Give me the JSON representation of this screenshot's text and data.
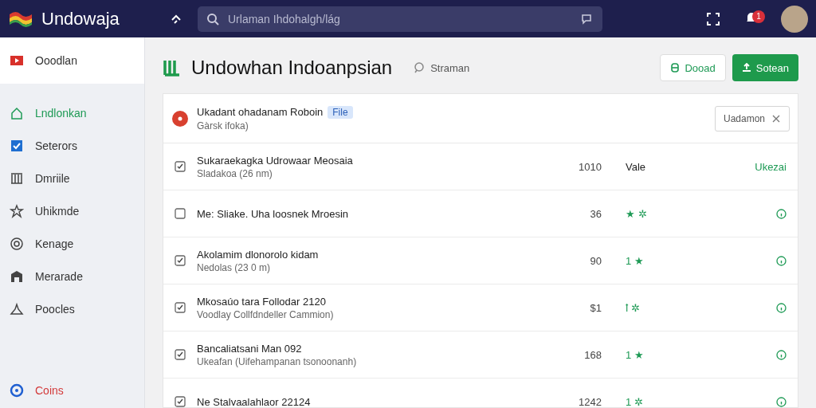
{
  "topbar": {
    "app_name": "Undowaja",
    "search": {
      "placeholder": "Urlaman Ihdohalgh/lág"
    },
    "notification_badge": "1"
  },
  "sidebar": {
    "top_item": {
      "label": "Ooodlan"
    },
    "items": [
      {
        "label": "Lndlonkan",
        "selected": true
      },
      {
        "label": "Seterors",
        "selected": false
      },
      {
        "label": "Dmriile",
        "selected": false
      },
      {
        "label": "Uhikmde",
        "selected": false
      },
      {
        "label": "Kenage",
        "selected": false
      },
      {
        "label": "Merarade",
        "selected": false
      },
      {
        "label": "Poocles",
        "selected": false
      }
    ],
    "bottom_item": {
      "label": "Coins"
    }
  },
  "header": {
    "title": "Undowhan Indoanpsian",
    "subtitle": "Straman",
    "buttons": [
      {
        "label": "Dooad",
        "kind": "outline"
      },
      {
        "label": "Sotean",
        "kind": "primary"
      }
    ]
  },
  "card": {
    "title": "Ukadant ohadanam Roboin",
    "tag": "File",
    "subtitle": "Gàrsk ifoka)",
    "filter_chip": "Uadamon",
    "rows": [
      {
        "title": "Sukaraekagka Udrowaar Meosaia",
        "subtitle": "Sladakoa (26 nm)",
        "checked": true,
        "number": "1010",
        "rating": "Vale",
        "end": {
          "kind": "label",
          "text": "Ukezai"
        }
      },
      {
        "title": "Me: Sliake. Uha loosnek Mroesin",
        "checked": false,
        "number": "36",
        "rating": "★ ✲",
        "end": {
          "kind": "info"
        }
      },
      {
        "title": "Akolamim dlonorolo kidam",
        "subtitle": "Nedolas (23 0 m)",
        "checked": true,
        "number": "90",
        "rating": "1 ★",
        "end": {
          "kind": "info"
        }
      },
      {
        "title": "Mkosaúo tara Follodar 2120",
        "subtitle": "Voodlay Collfdndeller Cammion)",
        "checked": true,
        "number": "$1",
        "rating": "ꝉ ✲",
        "end": {
          "kind": "info"
        }
      },
      {
        "title": "Bancaliatsani Man 092",
        "subtitle": "Ukeafan (Uifehampanan tsonoonanh)",
        "checked": true,
        "number": "168",
        "rating": "1 ★",
        "end": {
          "kind": "info"
        }
      },
      {
        "title": "Ne Stalvaalahlaor 22124",
        "checked": true,
        "number": "1242",
        "rating": "1 ✲",
        "end": {
          "kind": "info"
        }
      }
    ]
  }
}
